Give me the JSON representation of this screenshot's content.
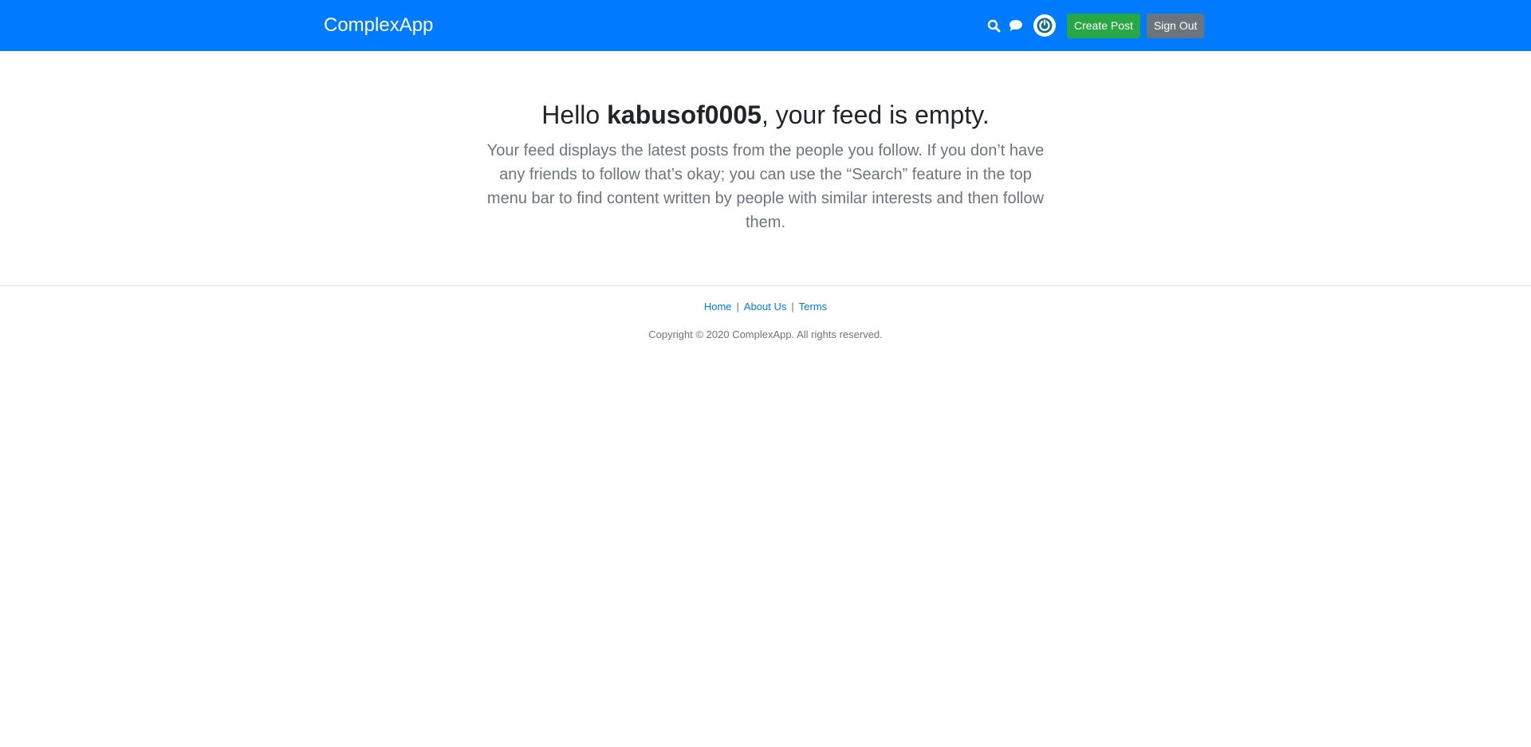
{
  "header": {
    "brand": "ComplexApp",
    "search_icon": "search-icon",
    "chat_icon": "chat-icon",
    "avatar_icon": "power-icon",
    "create_post_label": "Create Post",
    "sign_out_label": "Sign Out"
  },
  "main": {
    "greeting_prefix": "Hello ",
    "username": "kabusof0005",
    "greeting_suffix": ", your feed is empty.",
    "lead": "Your feed displays the latest posts from the people you follow. If you don’t have any friends to follow that’s okay; you can use the “Search” feature in the top menu bar to find content written by people with similar interests and then follow them."
  },
  "footer": {
    "links": [
      "Home",
      "About Us",
      "Terms"
    ],
    "separator": "|",
    "copyright": "Copyright © 2020 ComplexApp. All rights reserved."
  },
  "colors": {
    "navbar": "#007bff",
    "success": "#28a745",
    "secondary": "#6c757d"
  }
}
